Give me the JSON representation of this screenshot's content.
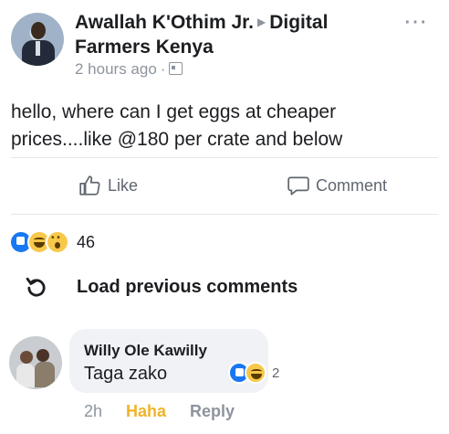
{
  "post": {
    "author": "Awallah K'Othim Jr.",
    "group": "Digital Farmers Kenya",
    "time": "2 hours ago",
    "text": "hello, where can I get eggs at cheaper prices....like @180 per crate and below"
  },
  "actions": {
    "like_label": "Like",
    "comment_label": "Comment"
  },
  "reactions": {
    "types": [
      "like",
      "haha",
      "wow"
    ],
    "count": "46"
  },
  "comments": {
    "load_previous_label": "Load previous comments",
    "items": [
      {
        "author": "Willy Ole Kawilly",
        "text": "Taga zako",
        "reaction_types": [
          "like",
          "haha"
        ],
        "reaction_count": "2",
        "time": "2h",
        "user_reaction": "Haha",
        "reply_label": "Reply"
      }
    ]
  },
  "colors": {
    "like_blue": "#1877f2",
    "haha_yellow": "#f0b428",
    "muted": "#8d949e"
  }
}
